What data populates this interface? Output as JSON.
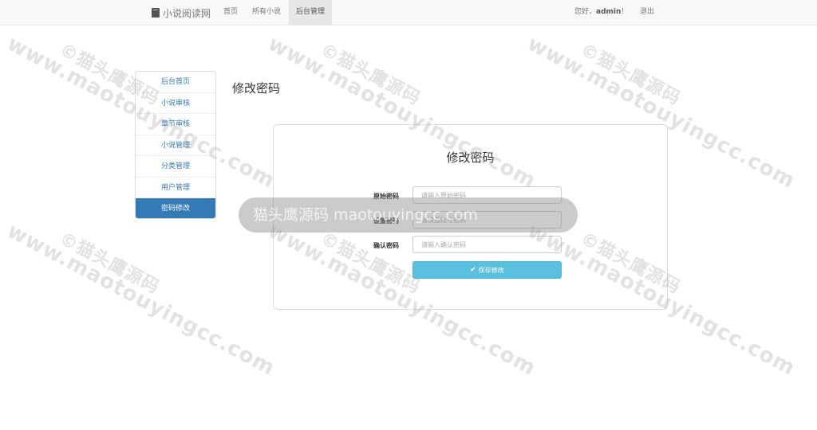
{
  "navbar": {
    "brand": "小说阅读网",
    "items": [
      {
        "label": "首页"
      },
      {
        "label": "所有小说"
      },
      {
        "label": "后台管理"
      }
    ],
    "greeting_prefix": "您好，",
    "username": "admin",
    "greeting_suffix": "！",
    "logout_label": "退出"
  },
  "sidebar": {
    "items": [
      {
        "label": "后台首页"
      },
      {
        "label": "小说审核"
      },
      {
        "label": "章节审核"
      },
      {
        "label": "小说管理"
      },
      {
        "label": "分类管理"
      },
      {
        "label": "用户管理"
      },
      {
        "label": "密码修改"
      }
    ]
  },
  "page": {
    "title": "修改密码"
  },
  "form": {
    "title": "修改密码",
    "fields": [
      {
        "label": "原始密码",
        "placeholder": "请输入原始密码",
        "value": ""
      },
      {
        "label": "设置密码",
        "placeholder": "请设置账号密码",
        "value": ""
      },
      {
        "label": "确认密码",
        "placeholder": "请输入确认密码",
        "value": ""
      }
    ],
    "submit_label": "保存修改"
  },
  "watermark": {
    "text": "www.maotouyingcc.com",
    "cn_text": "©猫头鹰源码",
    "banner_text": "猫头鹰源码 maotouyingcc.com"
  },
  "icons": {
    "brand": "book-icon",
    "submit": "check-icon"
  }
}
